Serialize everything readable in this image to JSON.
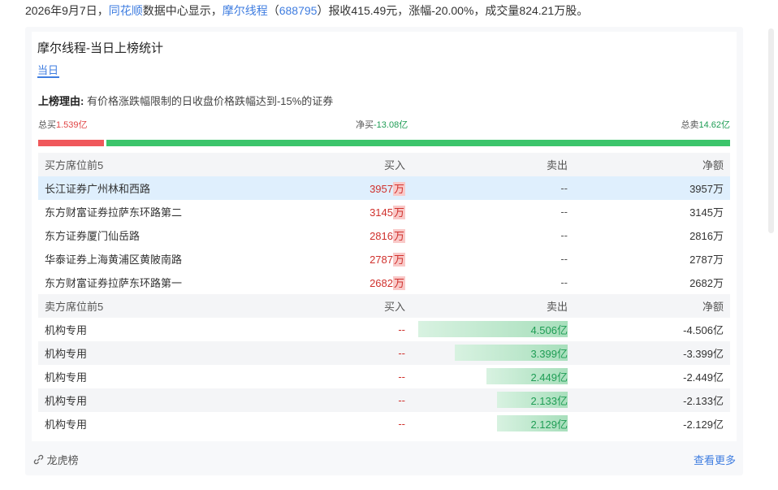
{
  "headline": {
    "date": "2026年9月7日，",
    "source_link": "同花顺",
    "source_text": "数据中心显示，",
    "stock_name": "摩尔线程",
    "code_open": "（",
    "stock_code": "688795",
    "code_close": "）",
    "summary": "报收415.49元，涨幅-20.00%，成交量824.21万股。"
  },
  "card": {
    "title": "摩尔线程-当日上榜统计",
    "tab": "当日",
    "reason_label": "上榜理由:",
    "reason_text": " 有价格涨跌幅限制的日收盘价格跌幅达到-15%的证券"
  },
  "summary": {
    "buy_label": "总买",
    "buy_value": "1.539亿",
    "net_label": "净买",
    "net_value": "-13.08亿",
    "sell_label": "总卖",
    "sell_value": "14.62亿",
    "buy_share": 0.0952
  },
  "columns": {
    "buy_title": "买方席位前5",
    "sell_title": "卖方席位前5",
    "buy": "买入",
    "sell": "卖出",
    "net": "净额"
  },
  "buyers": [
    {
      "name": "长江证券广州林和西路",
      "buy_num": "3957",
      "unit": "万",
      "sell": "--",
      "net": "3957万"
    },
    {
      "name": "东方财富证券拉萨东环路第二",
      "buy_num": "3145",
      "unit": "万",
      "sell": "--",
      "net": "3145万"
    },
    {
      "name": "东方证券厦门仙岳路",
      "buy_num": "2816",
      "unit": "万",
      "sell": "--",
      "net": "2816万"
    },
    {
      "name": "华泰证券上海黄浦区黄陂南路",
      "buy_num": "2787",
      "unit": "万",
      "sell": "--",
      "net": "2787万"
    },
    {
      "name": "东方财富证券拉萨东环路第一",
      "buy_num": "2682",
      "unit": "万",
      "sell": "--",
      "net": "2682万"
    }
  ],
  "sellers": [
    {
      "name": "机构专用",
      "buy": "--",
      "sell": "4.506亿",
      "sell_amount": 4.506,
      "net": "-4.506亿"
    },
    {
      "name": "机构专用",
      "buy": "--",
      "sell": "3.399亿",
      "sell_amount": 3.399,
      "net": "-3.399亿"
    },
    {
      "name": "机构专用",
      "buy": "--",
      "sell": "2.449亿",
      "sell_amount": 2.449,
      "net": "-2.449亿"
    },
    {
      "name": "机构专用",
      "buy": "--",
      "sell": "2.133亿",
      "sell_amount": 2.133,
      "net": "-2.133亿"
    },
    {
      "name": "机构专用",
      "buy": "--",
      "sell": "2.129亿",
      "sell_amount": 2.129,
      "net": "-2.129亿"
    }
  ],
  "footer": {
    "left": "龙虎榜",
    "right": "查看更多"
  },
  "colors": {
    "link": "#3f7de0",
    "buy_red": "#d0312d",
    "sell_green": "#1f9d55",
    "bar_red": "#f0585b",
    "bar_green": "#3cc56b"
  }
}
